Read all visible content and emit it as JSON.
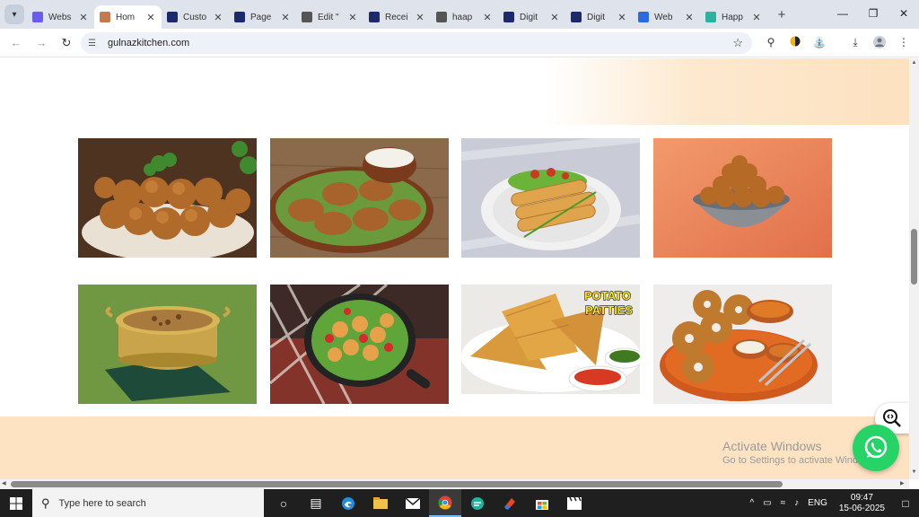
{
  "browser": {
    "tabs": [
      {
        "title": "Webs",
        "favicon_color": "#6b5cf0"
      },
      {
        "title": "Hom",
        "favicon_color": "#c47a4a",
        "active": true
      },
      {
        "title": "Custo",
        "favicon_color": "#1b2a6b"
      },
      {
        "title": "Page",
        "favicon_color": "#1b2a6b"
      },
      {
        "title": "Edit \"",
        "favicon_color": "#555555"
      },
      {
        "title": "Recei",
        "favicon_color": "#1b2a6b"
      },
      {
        "title": "haap",
        "favicon_color": "#555555"
      },
      {
        "title": "Digit",
        "favicon_color": "#1b2a6b"
      },
      {
        "title": "Digit",
        "favicon_color": "#1b2a6b"
      },
      {
        "title": "Web",
        "favicon_color": "#2a6be0"
      },
      {
        "title": "Happ",
        "favicon_color": "#2bb3a0"
      }
    ],
    "url": "gulnazkitchen.com"
  },
  "page": {
    "food_images": [
      {
        "name": "food-image-chicken-balls"
      },
      {
        "name": "food-image-aloo-tikki"
      },
      {
        "name": "food-image-spring-rolls"
      },
      {
        "name": "food-image-bread-balls"
      },
      {
        "name": "food-image-haleem-bowl"
      },
      {
        "name": "food-image-cheese-bites"
      },
      {
        "name": "food-image-potato-patties",
        "caption_line1": "POTATO",
        "caption_line2": "PATTIES"
      },
      {
        "name": "food-image-medu-vada"
      }
    ]
  },
  "overlay": {
    "activate_title": "Activate Windows",
    "activate_sub": "Go to Settings to activate Windows."
  },
  "taskbar": {
    "search_placeholder": "Type here to search",
    "lang": "ENG",
    "time": "09:47",
    "date": "15-06-2025"
  },
  "colors": {
    "peach": "#fee3c3",
    "whatsapp_green": "#25d366",
    "tab_bar": "#dfe3eb"
  }
}
